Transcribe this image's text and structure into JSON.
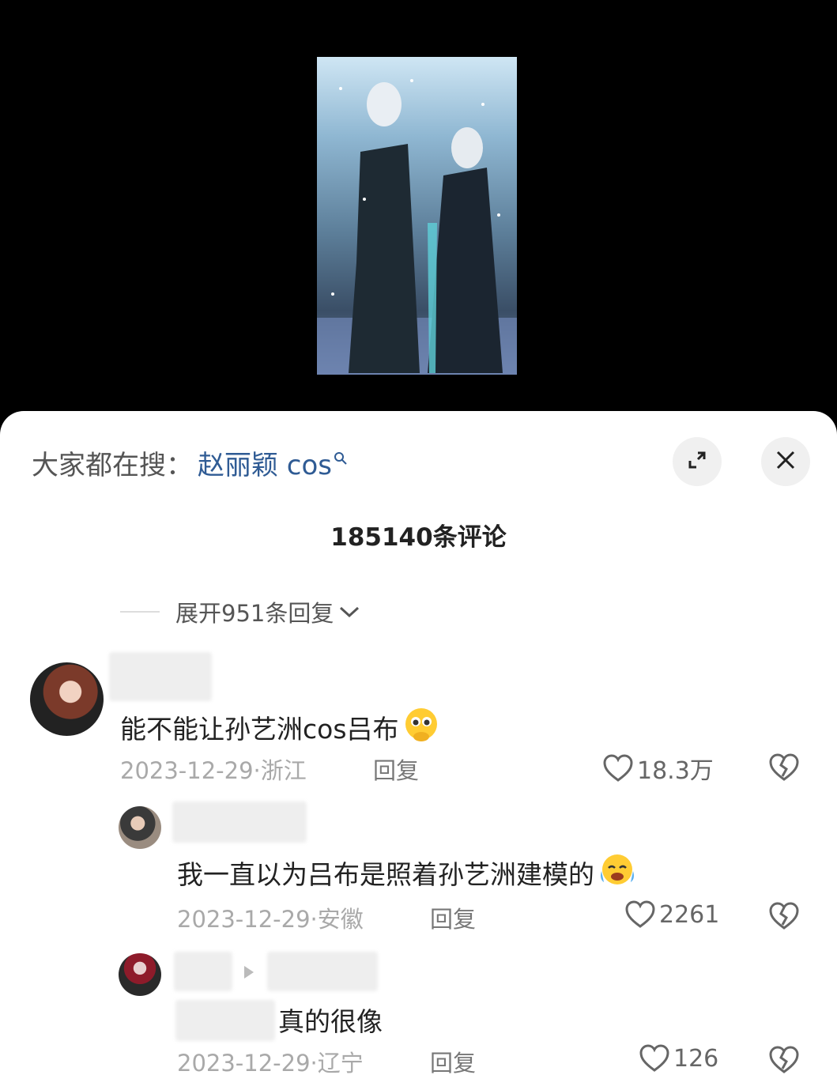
{
  "search": {
    "prefix": "大家都在搜：",
    "term": "赵丽颖 cos"
  },
  "comments_header": {
    "count_label": "185140条评论"
  },
  "expand_replies": {
    "label": "展开951条回复"
  },
  "comments": [
    {
      "text": "能不能让孙艺洲cos吕布",
      "emoji": "pleading-face",
      "date": "2023-12-29",
      "location": "浙江",
      "reply_label": "回复",
      "likes": "18.3万"
    },
    {
      "text": "我一直以为吕布是照着孙艺洲建模的",
      "emoji": "crying-face",
      "date": "2023-12-29",
      "location": "安徽",
      "reply_label": "回复",
      "likes": "2261"
    },
    {
      "text": "真的很像",
      "date": "2023-12-29",
      "location": "辽宁",
      "reply_label": "回复",
      "likes": "126"
    }
  ],
  "icons": [
    "search-icon",
    "expand-icon",
    "close-icon",
    "chevron-down-icon",
    "heart-icon",
    "broken-heart-icon",
    "reply-arrow-icon"
  ],
  "colors": {
    "background": "#000000",
    "sheet": "#ffffff",
    "link": "#2f5b94",
    "meta": "#a9a9a9"
  }
}
